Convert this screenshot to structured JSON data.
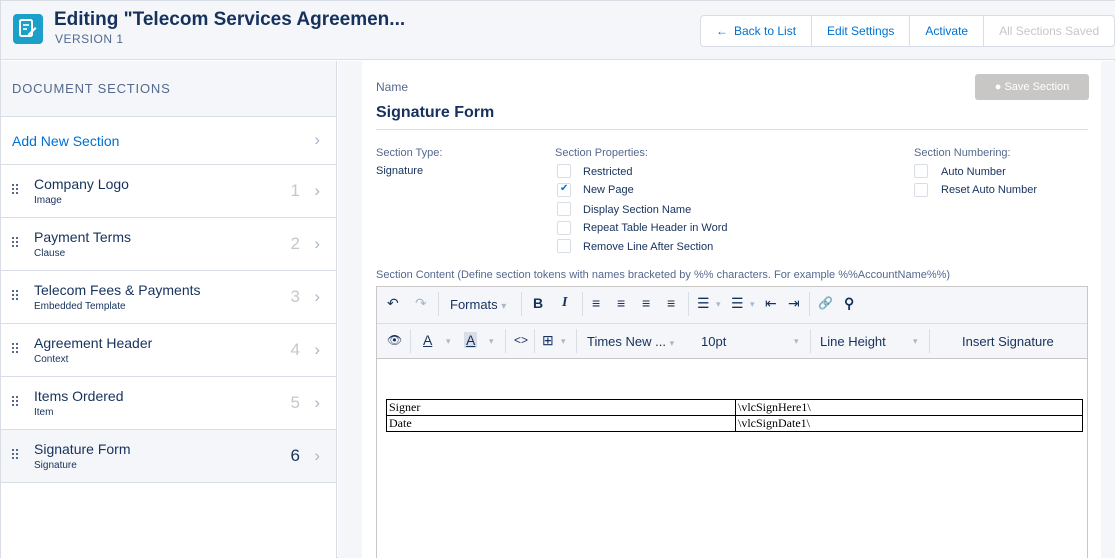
{
  "header": {
    "title": "Editing \"Telecom Services Agreemen...",
    "version": "VERSION 1",
    "buttons": {
      "back_arrow": "←",
      "back": "Back to List",
      "edit_settings": "Edit Settings",
      "activate": "Activate",
      "saved": "All Sections Saved"
    }
  },
  "sidebar": {
    "heading": "DOCUMENT SECTIONS",
    "add_new": "Add New Section",
    "chevron": "›",
    "sections": [
      {
        "name": "Company Logo",
        "type": "Image",
        "num": "1"
      },
      {
        "name": "Payment Terms",
        "type": "Clause",
        "num": "2"
      },
      {
        "name": "Telecom Fees & Payments",
        "type": "Embedded Template",
        "num": "3"
      },
      {
        "name": "Agreement Header",
        "type": "Context",
        "num": "4"
      },
      {
        "name": "Items Ordered",
        "type": "Item",
        "num": "5"
      },
      {
        "name": "Signature Form",
        "type": "Signature",
        "num": "6"
      }
    ]
  },
  "form": {
    "name_label": "Name",
    "section_name": "Signature Form",
    "save_button": "Save Section",
    "save_icon": "●",
    "section_type_label": "Section Type:",
    "section_type_value": "Signature",
    "properties_label": "Section Properties:",
    "properties": [
      {
        "label": "Restricted",
        "checked": false
      },
      {
        "label": "New Page",
        "checked": true
      },
      {
        "label": "Display Section Name",
        "checked": false
      },
      {
        "label": "Repeat Table Header in Word",
        "checked": false
      },
      {
        "label": "Remove Line After Section",
        "checked": false
      }
    ],
    "numbering_label": "Section Numbering:",
    "numbering": [
      {
        "label": "Auto Number",
        "checked": false
      },
      {
        "label": "Reset Auto Number",
        "checked": false
      }
    ],
    "content_label": "Section Content (Define section tokens with names bracketed by %% characters. For example %%AccountName%%)"
  },
  "toolbar": {
    "undo": "↶",
    "redo": "↷",
    "formats": "Formats",
    "bold": "B",
    "italic": "I",
    "caret": "▾",
    "align_left": "≡",
    "align_center": "≡",
    "align_right": "≡",
    "justify": "≡",
    "bullets": "☰",
    "numbered": "☰",
    "outdent": "⇤",
    "indent": "⇥",
    "link": "🔗",
    "find": "⚲",
    "preview": "👁",
    "text_color": "A",
    "bg_color": "A",
    "code": "<>",
    "table": "⊞",
    "font": "Times New ...",
    "size": "10pt",
    "line_height": "Line Height",
    "insert_signature": "Insert Signature"
  },
  "signature_table": [
    {
      "label": "Signer",
      "token": "\\vlcSignHere1\\"
    },
    {
      "label": "Date",
      "token": "\\vlcSignDate1\\"
    }
  ],
  "colors": {
    "accent": "#0070d2",
    "logo": "#1ba1c9",
    "panel_bg": "#f4f6f9"
  }
}
